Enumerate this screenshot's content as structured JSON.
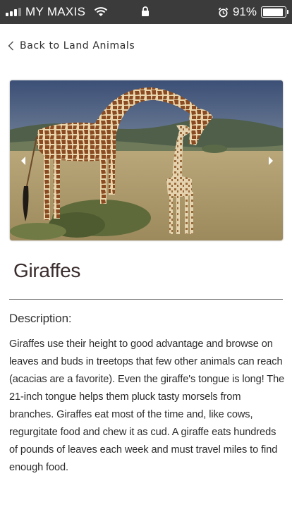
{
  "status_bar": {
    "carrier": "MY MAXIS",
    "battery_percent": "91%",
    "battery_level": 0.91,
    "icons": [
      "signal-icon",
      "wifi-icon",
      "lock-icon",
      "alarm-icon",
      "battery-icon"
    ]
  },
  "nav": {
    "back_label": "Back to Land Animals"
  },
  "carousel": {
    "image_alt": "Adult giraffe bending down toward a baby giraffe on the savanna",
    "prev_icon": "chevron-left-icon",
    "next_icon": "chevron-right-icon"
  },
  "animal": {
    "name": "Giraffes",
    "description_label": "Description:",
    "description": "Giraffes use their height to good advantage and browse on leaves and buds in treetops that few other animals can reach (acacias are a favorite). Even the giraffe's tongue is long! The 21-inch tongue helps them pluck tasty morsels from branches. Giraffes eat most of the time and, like cows, regurgitate food and chew it as cud. A giraffe eats hundreds of pounds of leaves each week and must travel miles to find enough food."
  },
  "colors": {
    "status_bar_bg": "#3b3b3b",
    "title_text": "#3a2d2d",
    "body_text": "#2b2b2b"
  }
}
